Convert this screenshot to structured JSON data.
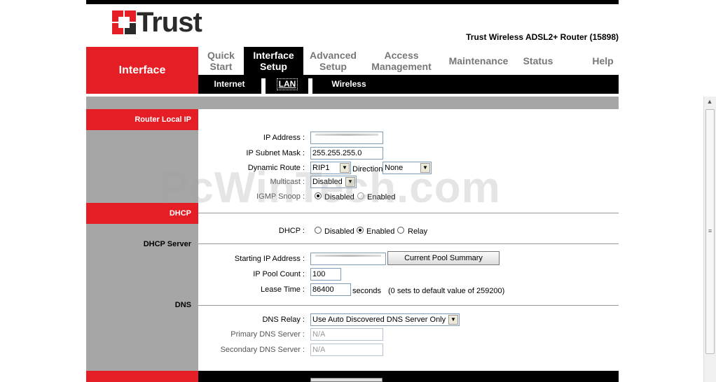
{
  "brand": {
    "logo_text": "Trust",
    "product": "Trust Wireless ADSL2+ Router (15898)"
  },
  "section": "Interface",
  "nav": [
    {
      "label_1": "Quick",
      "label_2": "Start"
    },
    {
      "label_1": "Interface",
      "label_2": "Setup"
    },
    {
      "label_1": "Advanced",
      "label_2": "Setup"
    },
    {
      "label_1": "Access",
      "label_2": "Management"
    },
    {
      "label_1": "Maintenance"
    },
    {
      "label_1": "Status"
    },
    {
      "label_1": "Help"
    }
  ],
  "subnav": [
    "Internet",
    "LAN",
    "Wireless"
  ],
  "router_ip": {
    "heading": "Router Local IP",
    "ip_label": "IP Address :",
    "ip_value": "",
    "mask_label": "IP Subnet Mask :",
    "mask_value": "255.255.255.0",
    "route_label": "Dynamic Route :",
    "route_value": "RIP1",
    "direction_label": "Direction",
    "direction_value": "None",
    "multicast_label": "Multicast :",
    "multicast_value": "Disabled",
    "igmp_label": "IGMP Snoop :",
    "igmp_disabled": "Disabled",
    "igmp_enabled": "Enabled"
  },
  "dhcp": {
    "heading": "DHCP",
    "dhcp_label": "DHCP :",
    "opt_disabled": "Disabled",
    "opt_enabled": "Enabled",
    "opt_relay": "Relay",
    "server_heading": "DHCP Server",
    "start_label": "Starting IP Address :",
    "start_value": "",
    "pool_button": "Current Pool Summary",
    "count_label": "IP Pool Count :",
    "count_value": "100",
    "lease_label": "Lease Time :",
    "lease_value": "86400",
    "lease_unit": "seconds",
    "lease_note": "(0 sets to default value of 259200)"
  },
  "dns": {
    "heading": "DNS",
    "relay_label": "DNS Relay :",
    "relay_value": "Use Auto Discovered DNS Server Only",
    "primary_label": "Primary DNS Server :",
    "primary_value": "N/A",
    "secondary_label": "Secondary DNS Server :",
    "secondary_value": "N/A"
  },
  "watermark": "PcWinTech.com",
  "colors": {
    "brand_red": "#e51e25",
    "panel_grey": "#a6a6a6",
    "nav_active": "#000000"
  }
}
